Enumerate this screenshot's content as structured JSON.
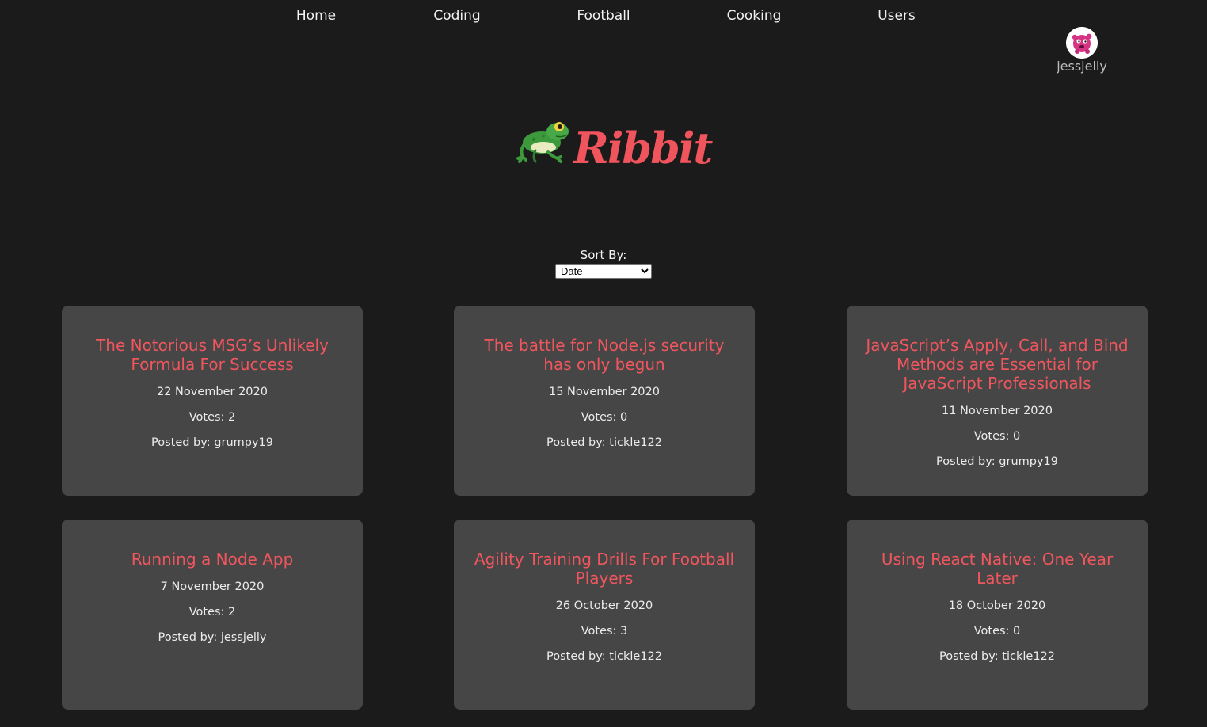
{
  "nav": {
    "items": [
      {
        "label": "Home"
      },
      {
        "label": "Coding"
      },
      {
        "label": "Football"
      },
      {
        "label": "Cooking"
      },
      {
        "label": "Users"
      }
    ]
  },
  "user": {
    "username": "jessjelly",
    "avatar_icon": "pink-monster-avatar"
  },
  "logo": {
    "text": "Ribbit",
    "icon": "frog-icon",
    "color": "#f0545c"
  },
  "sort": {
    "label": "Sort By:",
    "selected": "Date"
  },
  "articles": [
    {
      "title": "The Notorious MSG’s Unlikely Formula For Success",
      "date": "22 November 2020",
      "votes": "Votes: 2",
      "author": "Posted by: grumpy19"
    },
    {
      "title": "The battle for Node.js security has only begun",
      "date": "15 November 2020",
      "votes": "Votes: 0",
      "author": "Posted by: tickle122"
    },
    {
      "title": "JavaScript’s Apply, Call, and Bind Methods are Essential for JavaScript Professionals",
      "date": "11 November 2020",
      "votes": "Votes: 0",
      "author": "Posted by: grumpy19"
    },
    {
      "title": "Running a Node App",
      "date": "7 November 2020",
      "votes": "Votes: 2",
      "author": "Posted by: jessjelly"
    },
    {
      "title": "Agility Training Drills For Football Players",
      "date": "26 October 2020",
      "votes": "Votes: 3",
      "author": "Posted by: tickle122"
    },
    {
      "title": "Using React Native: One Year Later",
      "date": "18 October 2020",
      "votes": "Votes: 0",
      "author": "Posted by: tickle122"
    }
  ],
  "colors": {
    "background": "#1b1b1b",
    "card": "#464646",
    "accent": "#f0565e"
  }
}
